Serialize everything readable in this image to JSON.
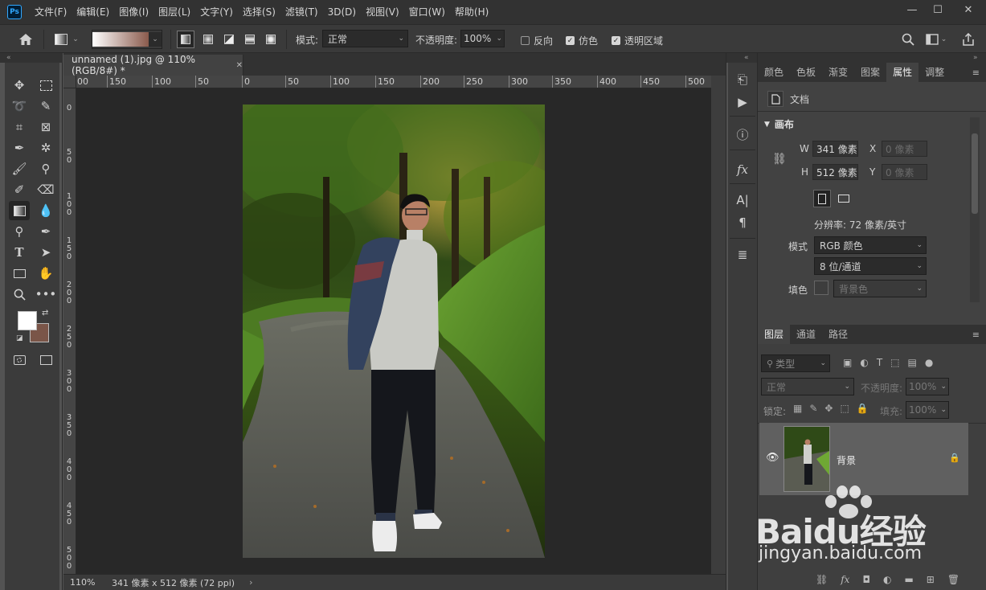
{
  "app": {
    "logo": "Ps"
  },
  "menu": [
    "文件(F)",
    "编辑(E)",
    "图像(I)",
    "图层(L)",
    "文字(Y)",
    "选择(S)",
    "滤镜(T)",
    "3D(D)",
    "视图(V)",
    "窗口(W)",
    "帮助(H)"
  ],
  "window_controls": {
    "minimize": "—",
    "maximize": "☐",
    "close": "✕"
  },
  "options": {
    "mode_label": "模式:",
    "mode_value": "正常",
    "opacity_label": "不透明度:",
    "opacity_value": "100%",
    "reverse_label": "反向",
    "reverse_checked": false,
    "dither_label": "仿色",
    "dither_checked": true,
    "transparency_label": "透明区域",
    "transparency_checked": true
  },
  "document": {
    "tab_title": "unnamed (1).jpg @ 110%(RGB/8#) *",
    "zoom": "110%",
    "size_info": "341 像素 x 512 像素 (72 ppi)"
  },
  "ruler": {
    "top_labels": [
      "00",
      "150",
      "100",
      "50",
      "0",
      "50",
      "100",
      "150",
      "200",
      "250",
      "300",
      "350",
      "400",
      "450",
      "500"
    ],
    "left_labels": [
      "0",
      "5\n0",
      "1\n0\n0",
      "1\n5\n0",
      "2\n0\n0",
      "2\n5\n0",
      "3\n0\n0",
      "3\n5\n0",
      "4\n0\n0",
      "4\n5\n0",
      "5\n0\n0"
    ]
  },
  "properties_panel": {
    "tabs": [
      "颜色",
      "色板",
      "渐变",
      "图案",
      "属性",
      "调整"
    ],
    "active_tab": "属性",
    "doc_label": "文档",
    "canvas_section": "画布",
    "w_label": "W",
    "w_value": "341 像素",
    "h_label": "H",
    "h_value": "512 像素",
    "x_label": "X",
    "x_value": "0 像素",
    "y_label": "Y",
    "y_value": "0 像素",
    "resolution": "分辨率: 72 像素/英寸",
    "mode_label": "模式",
    "mode_value": "RGB 颜色",
    "depth_value": "8 位/通道",
    "fill_label": "填色",
    "fill_value": "背景色"
  },
  "layers_panel": {
    "tabs": [
      "图层",
      "通道",
      "路径"
    ],
    "active_tab": "图层",
    "filter_placeholder": "类型",
    "blend_mode": "正常",
    "opacity_label": "不透明度:",
    "opacity_value": "100%",
    "lock_label": "锁定:",
    "fill_label": "填充:",
    "fill_value": "100%",
    "layers": [
      {
        "name": "背景",
        "visible": true,
        "locked": true
      }
    ]
  },
  "watermark": {
    "brand": "Baidu经验",
    "url": "jingyan.baidu.com"
  },
  "colors": {
    "foreground": "#ffffff",
    "background": "#7a5548",
    "accent": "#31a8ff"
  }
}
